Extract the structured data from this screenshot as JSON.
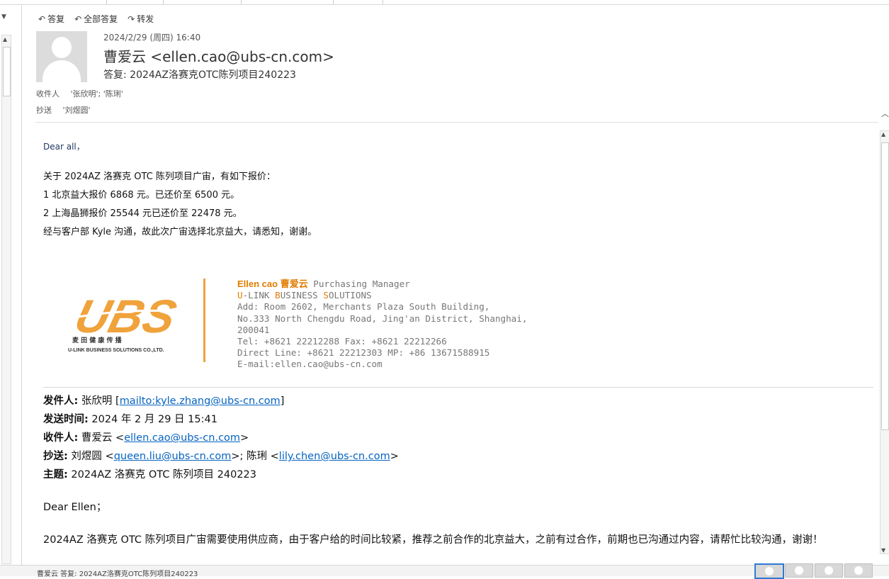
{
  "toolbar": {
    "actions": [
      {
        "label": "答复",
        "icon": "reply-icon"
      },
      {
        "label": "全部答复",
        "icon": "reply-all-icon"
      },
      {
        "label": "转发",
        "icon": "forward-icon"
      }
    ]
  },
  "header": {
    "date": "2024/2/29 (周四) 16:40",
    "from": "曹爱云 <ellen.cao@ubs-cn.com>",
    "subject": "答复: 2024AZ洛赛克OTC陈列项目240223",
    "to_label": "收件人",
    "to_value": "'张欣明'; '陈琍'",
    "cc_label": "抄送",
    "cc_value": "'刘煜圆'"
  },
  "body": {
    "greeting": "Dear all，",
    "lines": [
      "关于 2024AZ 洛赛克 OTC 陈列项目广宙，有如下报价：",
      "1 北京益大报价 6868 元。已还价至 6500 元。",
      "2 上海晶狮报价 25544 元已还价至 22478 元。",
      "经与客户部 Kyle 沟通，故此次广宙选择北京益大，请悉知，谢谢。"
    ]
  },
  "signature": {
    "name": "Ellen cao 曹爱云",
    "title": " Purchasing Manager",
    "company_parts": [
      {
        "t": "U",
        "accent": true
      },
      {
        "t": "-LINK ",
        "accent": false
      },
      {
        "t": "B",
        "accent": true
      },
      {
        "t": "USINESS ",
        "accent": false
      },
      {
        "t": "S",
        "accent": true
      },
      {
        "t": "OLUTIONS",
        "accent": false
      }
    ],
    "lines": [
      "Add: Room 2602, Merchants Plaza South Building,",
      "No.333 North Chengdu Road, Jing'an District, Shanghai, 200041",
      "Tel: +8621 22212288  Fax: +8621 22212266",
      "Direct Line: +8621 22212303   MP: +86 13671588915",
      "E-mail:ellen.cao@ubs-cn.com"
    ],
    "logo_text": "UBS",
    "logo_cn": "麦 田 健 康 传 播",
    "logo_en": "U-LINK BUSINESS SOLUTIONS CO.,LTD.",
    "logo_color": "#f0a23b"
  },
  "quoted": {
    "from_label": "发件人:",
    "from_name": " 张欣明 [",
    "from_link": "mailto:kyle.zhang@ubs-cn.com",
    "from_end": "]",
    "sent_label": "发送时间:",
    "sent_value": " 2024 年 2 月 29 日 15:41",
    "to_label": "收件人:",
    "to_name": " 曹爱云 <",
    "to_link": "ellen.cao@ubs-cn.com",
    "to_end": ">",
    "cc_label": "抄送:",
    "cc_name1": " 刘煜圆 <",
    "cc_link1": "queen.liu@ubs-cn.com",
    "cc_mid": ">; 陈琍 <",
    "cc_link2": "lily.chen@ubs-cn.com",
    "cc_end": ">",
    "subject_label": "主题:",
    "subject_value": " 2024AZ 洛赛克 OTC 陈列项目 240223",
    "greeting": "Dear Ellen；",
    "text": "2024AZ 洛赛克 OTC 陈列项目广宙需要使用供应商，由于客户给的时间比较紧，推荐之前合作的北京益大，之前有过合作，前期也已沟通过内容，请帮忙比较沟通，谢谢！"
  },
  "status": {
    "text": "曹爱云 答复: 2024AZ洛赛克OTC陈列项目240223"
  }
}
